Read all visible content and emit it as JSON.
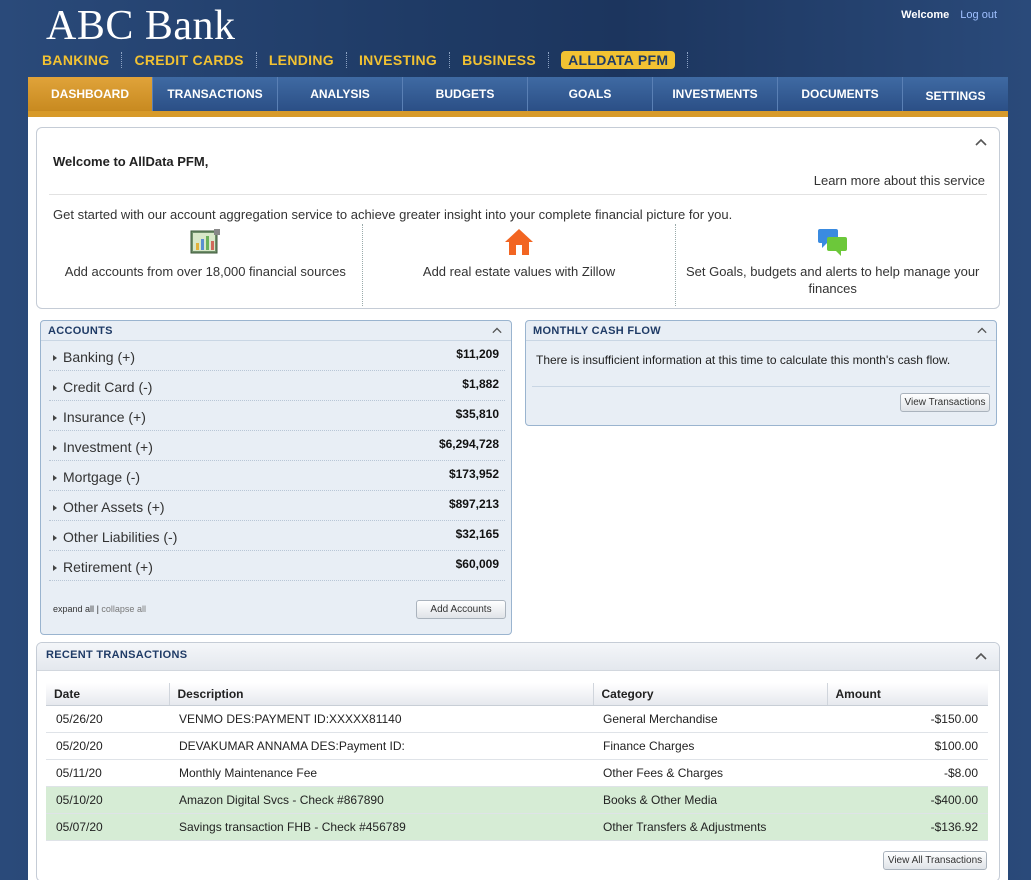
{
  "header": {
    "brand": "ABC Bank",
    "welcome": "Welcome",
    "logout": "Log out",
    "primary_nav": [
      "BANKING",
      "CREDIT CARDS",
      "LENDING",
      "INVESTING",
      "BUSINESS",
      "ALLDATA PFM"
    ],
    "active_primary": "ALLDATA PFM"
  },
  "tabs": [
    "DASHBOARD",
    "TRANSACTIONS",
    "ANALYSIS",
    "BUDGETS",
    "GOALS",
    "INVESTMENTS",
    "DOCUMENTS",
    "SETTINGS"
  ],
  "active_tab": "DASHBOARD",
  "welcome_box": {
    "title": "Welcome to AllData PFM,",
    "learn_more": "Learn more about this service",
    "intro": "Get started with our account aggregation service to achieve greater insight into your complete financial picture for you.",
    "features": [
      {
        "icon": "chart-icon",
        "text": "Add accounts from over 18,000 financial sources"
      },
      {
        "icon": "house-icon",
        "text": "Add real estate values with Zillow"
      },
      {
        "icon": "chat-bubbles-icon",
        "text": "Set Goals, budgets and alerts to help manage your finances"
      }
    ]
  },
  "accounts": {
    "title": "ACCOUNTS",
    "rows": [
      {
        "name": "Banking (+)",
        "value": "$11,209"
      },
      {
        "name": "Credit Card (-)",
        "value": "$1,882"
      },
      {
        "name": "Insurance (+)",
        "value": "$35,810"
      },
      {
        "name": "Investment (+)",
        "value": "$6,294,728"
      },
      {
        "name": "Mortgage (-)",
        "value": "$173,952"
      },
      {
        "name": "Other Assets (+)",
        "value": "$897,213"
      },
      {
        "name": "Other Liabilities (-)",
        "value": "$32,165"
      },
      {
        "name": "Retirement (+)",
        "value": "$60,009"
      }
    ],
    "expand_all": "expand all",
    "separator": "|",
    "collapse_all": "collapse all",
    "add_button": "Add Accounts"
  },
  "cash_flow": {
    "title": "MONTHLY CASH FLOW",
    "message": "There is insufficient information at this time to calculate this month's cash flow.",
    "button": "View Transactions"
  },
  "recent": {
    "title": "RECENT TRANSACTIONS",
    "columns": [
      "Date",
      "Description",
      "Category",
      "Amount"
    ],
    "rows": [
      {
        "date": "05/26/20",
        "desc": "VENMO DES:PAYMENT ID:XXXXX81140",
        "cat": "General Merchandise",
        "amt": "-$150.00"
      },
      {
        "date": "05/20/20",
        "desc": "DEVAKUMAR ANNAMA DES:Payment ID:",
        "cat": "Finance Charges",
        "amt": "$100.00"
      },
      {
        "date": "05/11/20",
        "desc": "Monthly Maintenance Fee",
        "cat": "Other Fees & Charges",
        "amt": "-$8.00"
      },
      {
        "date": "05/10/20",
        "desc": "Amazon Digital Svcs - Check #867890",
        "cat": "Books & Other Media",
        "amt": "-$400.00"
      },
      {
        "date": "05/07/20",
        "desc": "Savings transaction FHB - Check #456789",
        "cat": "Other Transfers & Adjustments",
        "amt": "-$136.92"
      }
    ],
    "view_all": "View All Transactions"
  }
}
